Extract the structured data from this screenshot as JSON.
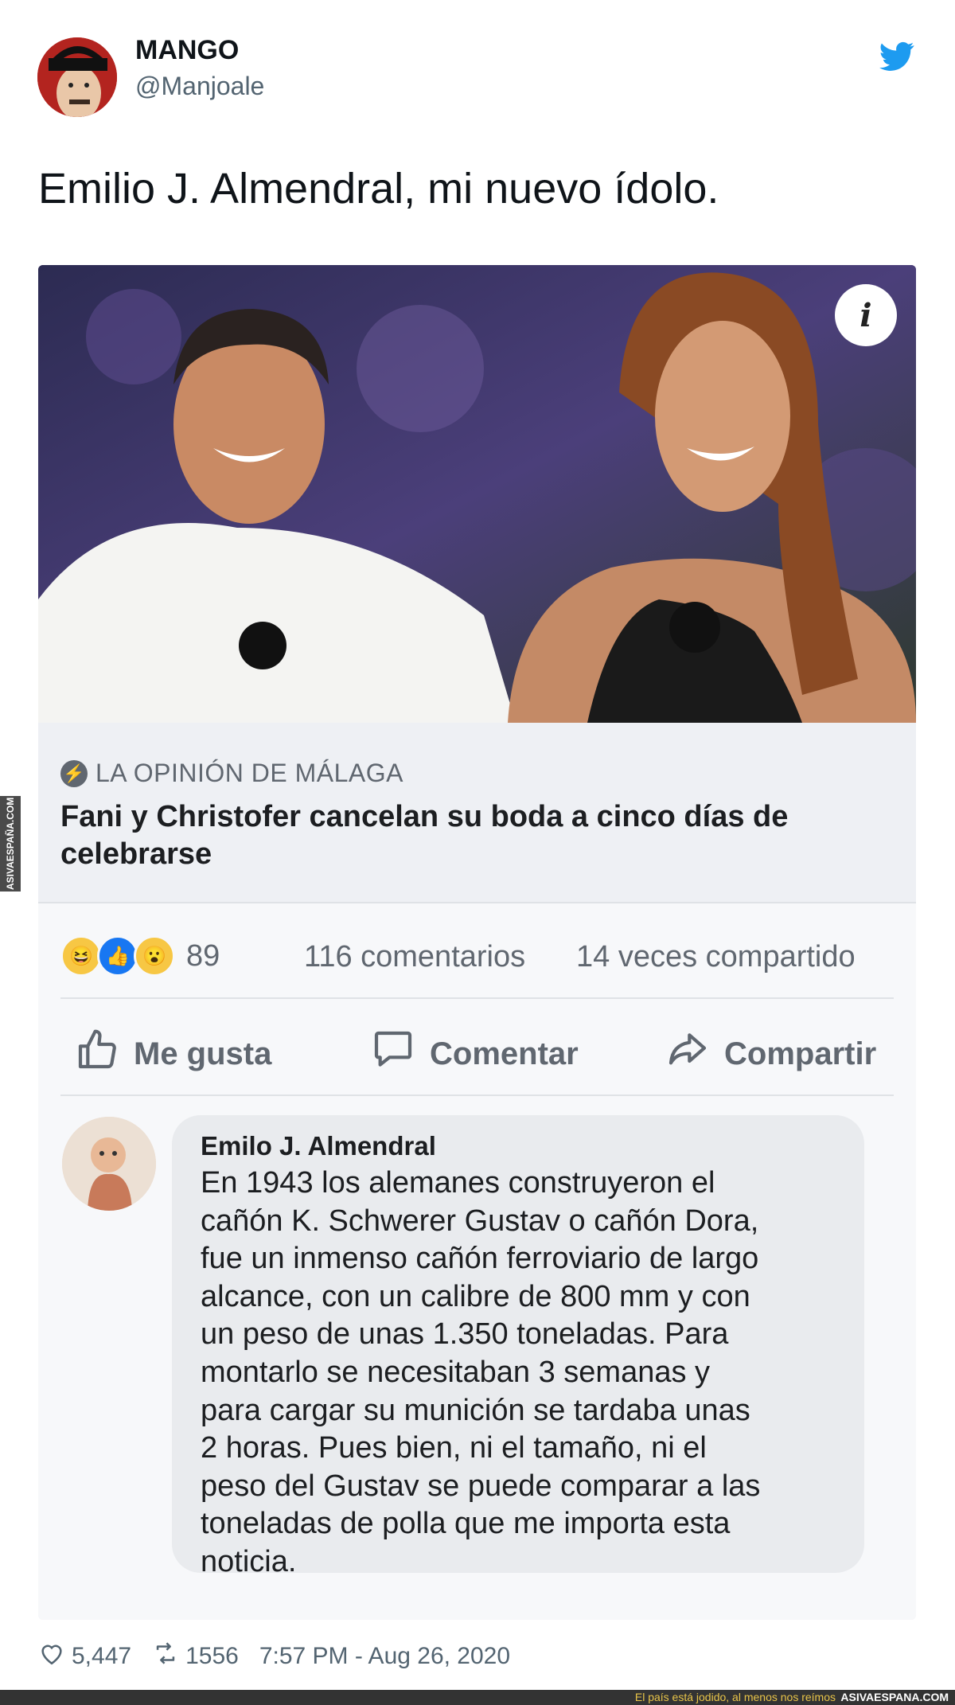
{
  "tweet": {
    "author_name": "MANGO",
    "author_handle": "@Manjoale",
    "text": "Emilio J. Almendral, mi nuevo ídolo.",
    "icons": {
      "brand": "twitter-bird-icon",
      "avatar": "user-avatar"
    },
    "brand_color": "#1d9bf0"
  },
  "post": {
    "source": "LA OPINIÓN DE MÁLAGA",
    "headline": "Fani y Christofer cancelan su boda a cinco días de celebrarse",
    "info_icon_label": "i",
    "reactions_count": "89",
    "comments_count": "116 comentarios",
    "shares_count": "14 veces compartido",
    "actions": {
      "like": "Me gusta",
      "comment": "Comentar",
      "share": "Compartir"
    }
  },
  "comment": {
    "author": "Emilo J. Almendral",
    "text": "En 1943 los alemanes construyeron el\ncañón K. Schwerer Gustav o cañón Dora,\nfue un inmenso cañón ferroviario de largo\nalcance, con un calibre de 800 mm y con\nun peso de unas 1.350 toneladas. Para\nmontarlo se necesitaban 3 semanas y\npara cargar su munición se tardaba unas\n2 horas. Pues bien, ni el tamaño, ni el\npeso del Gustav se puede comparar a las\ntoneladas de polla que me importa esta\nnoticia."
  },
  "footer": {
    "likes": "5,447",
    "retweets": "1556",
    "timestamp": "7:57 PM - Aug 26, 2020"
  },
  "watermark": {
    "side_text": "ASIVAESPAÑA.COM",
    "bottom_tagline": "El país está jodido, al menos nos reímos",
    "bottom_site": "ASIVAESPANA.COM"
  }
}
